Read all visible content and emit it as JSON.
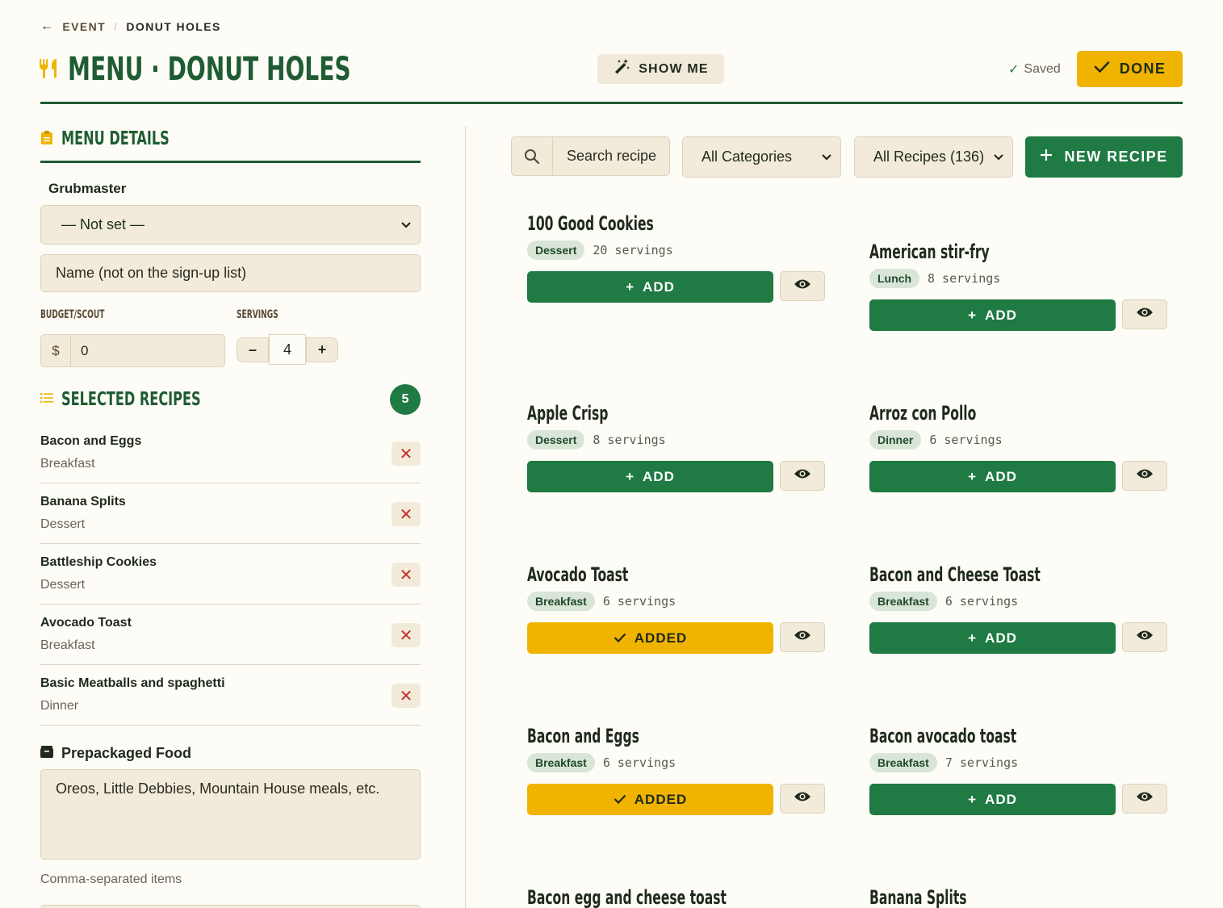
{
  "breadcrumb": {
    "back_label": "EVENT",
    "separator": "/",
    "current": "DONUT HOLES"
  },
  "header": {
    "title": "MENU · DONUT HOLES",
    "show_me_label": "SHOW ME",
    "saved_label": "Saved",
    "done_label": "DONE"
  },
  "menu_details": {
    "section_title": "MENU DETAILS",
    "grubmaster_label": "Grubmaster",
    "grubmaster_value": "— Not set —",
    "name_placeholder": "Name (not on the sign-up list)",
    "budget_label": "BUDGET/SCOUT",
    "budget_currency": "$",
    "budget_value": "0",
    "servings_label": "SERVINGS",
    "servings_minus": "–",
    "servings_value": "4",
    "servings_plus": "+"
  },
  "selected_recipes": {
    "section_title": "SELECTED RECIPES",
    "count": "5",
    "items": [
      {
        "name": "Bacon and Eggs",
        "category": "Breakfast"
      },
      {
        "name": "Banana Splits",
        "category": "Dessert"
      },
      {
        "name": "Battleship Cookies",
        "category": "Dessert"
      },
      {
        "name": "Avocado Toast",
        "category": "Breakfast"
      },
      {
        "name": "Basic Meatballs and spaghetti",
        "category": "Dinner"
      }
    ]
  },
  "prepackaged": {
    "title": "Prepackaged Food",
    "value": "Oreos, Little Debbies, Mountain House meals, etc.",
    "hint": "Comma-separated items"
  },
  "toolbar": {
    "search_placeholder": "Search recipe",
    "category_value": "All Categories",
    "recipes_value": "All Recipes (136)",
    "new_recipe_label": "NEW RECIPE"
  },
  "labels": {
    "add": "ADD",
    "added": "ADDED"
  },
  "recipes": [
    {
      "name": "100 Good Cookies",
      "category": "Dessert",
      "servings": "20 servings",
      "added": false
    },
    {
      "name": "American stir-fry",
      "category": "Lunch",
      "servings": "8 servings",
      "added": false
    },
    {
      "name": "Apple Crisp",
      "category": "Dessert",
      "servings": "8 servings",
      "added": false
    },
    {
      "name": "Arroz con Pollo",
      "category": "Dinner",
      "servings": "6 servings",
      "added": false
    },
    {
      "name": "Avocado Toast",
      "category": "Breakfast",
      "servings": "6 servings",
      "added": true
    },
    {
      "name": "Bacon and Cheese Toast",
      "category": "Breakfast",
      "servings": "6 servings",
      "added": false
    },
    {
      "name": "Bacon and Eggs",
      "category": "Breakfast",
      "servings": "6 servings",
      "added": true
    },
    {
      "name": "Bacon avocado toast",
      "category": "Breakfast",
      "servings": "7 servings",
      "added": false
    },
    {
      "name": "Bacon egg and cheese toast"
    },
    {
      "name": "Banana Splits"
    }
  ],
  "colors": {
    "brand_green": "#1f5c33",
    "button_green": "#1f7a43",
    "accent_yellow": "#f0b400",
    "cream": "#f2ebda"
  }
}
